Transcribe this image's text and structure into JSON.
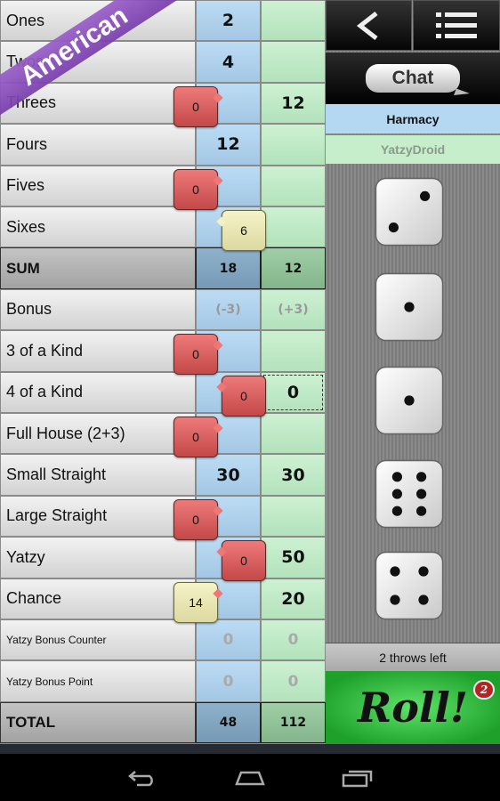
{
  "variant_ribbon": "American",
  "rows": [
    {
      "label": "Ones",
      "p1": "2",
      "p2": "",
      "type": "normal"
    },
    {
      "label": "Twos",
      "p1": "4",
      "p2": "",
      "type": "normal"
    },
    {
      "label": "Threes",
      "p1": "",
      "p2": "12",
      "type": "normal"
    },
    {
      "label": "Fours",
      "p1": "12",
      "p2": "",
      "type": "normal"
    },
    {
      "label": "Fives",
      "p1": "",
      "p2": "",
      "type": "normal"
    },
    {
      "label": "Sixes",
      "p1": "",
      "p2": "",
      "type": "normal"
    },
    {
      "label": "SUM",
      "p1": "18",
      "p2": "12",
      "type": "sum"
    },
    {
      "label": "Bonus",
      "p1": "(-3)",
      "p2": "(+3)",
      "type": "bonus"
    },
    {
      "label": "3 of a Kind",
      "p1": "",
      "p2": "",
      "type": "normal"
    },
    {
      "label": "4 of a Kind",
      "p1": "",
      "p2": "0",
      "type": "normal",
      "p2_selected": true
    },
    {
      "label": "Full House (2+3)",
      "p1": "",
      "p2": "",
      "type": "normal"
    },
    {
      "label": "Small Straight",
      "p1": "30",
      "p2": "30",
      "type": "normal"
    },
    {
      "label": "Large Straight",
      "p1": "",
      "p2": "",
      "type": "normal"
    },
    {
      "label": "Yatzy",
      "p1": "",
      "p2": "50",
      "type": "normal"
    },
    {
      "label": "Chance",
      "p1": "",
      "p2": "20",
      "type": "normal"
    },
    {
      "label": "Yatzy Bonus Counter",
      "p1": "0",
      "p2": "0",
      "type": "small"
    },
    {
      "label": "Yatzy Bonus Point",
      "p1": "0",
      "p2": "0",
      "type": "small"
    },
    {
      "label": "TOTAL",
      "p1": "48",
      "p2": "112",
      "type": "sum"
    }
  ],
  "suggestions": [
    {
      "row": "Threes",
      "value": "0",
      "kind": "miss"
    },
    {
      "row": "Fives",
      "value": "0",
      "kind": "miss"
    },
    {
      "row": "Sixes",
      "value": "6",
      "kind": "score"
    },
    {
      "row": "3 of a Kind",
      "value": "0",
      "kind": "miss"
    },
    {
      "row": "4 of a Kind",
      "value": "0",
      "kind": "miss"
    },
    {
      "row": "Full House (2+3)",
      "value": "0",
      "kind": "miss"
    },
    {
      "row": "Large Straight",
      "value": "0",
      "kind": "miss"
    },
    {
      "row": "Yatzy",
      "value": "0",
      "kind": "miss"
    },
    {
      "row": "Chance",
      "value": "14",
      "kind": "score"
    }
  ],
  "toolbar": {
    "back_icon": "chevron-left-icon",
    "menu_icon": "list-menu-icon",
    "chat_label": "Chat"
  },
  "players": [
    {
      "name": "Harmacy",
      "color": "#b4d8f2",
      "active": true
    },
    {
      "name": "YatzyDroid",
      "color": "#c6eecb",
      "active": false
    }
  ],
  "dice": [
    2,
    1,
    1,
    6,
    4
  ],
  "throws_left": "2 throws left",
  "roll_label": "Roll!",
  "roll_badge": "2",
  "nav": [
    "back-icon",
    "home-icon",
    "recent-apps-icon"
  ]
}
